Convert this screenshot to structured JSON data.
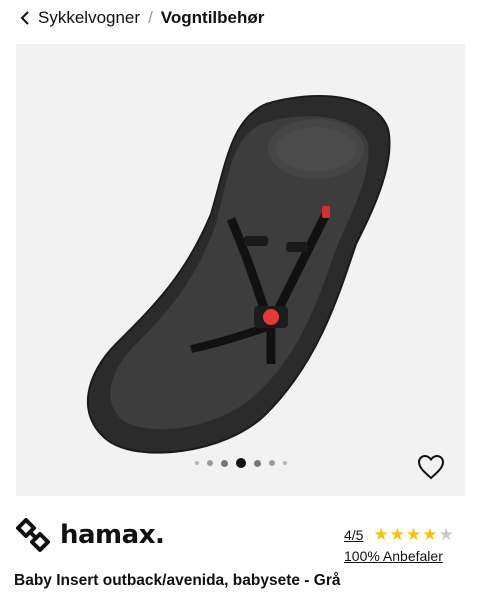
{
  "breadcrumb": {
    "back_label": "Sykkelvogner",
    "separator": "/",
    "current": "Vogntilbehør"
  },
  "gallery": {
    "image_alt": "Baby Insert outback/avenida, babysete - Grå",
    "dot_count": 7,
    "active_index": 3
  },
  "brand": {
    "name": "hamax."
  },
  "rating": {
    "score_label": "4/5",
    "stars_filled": 4,
    "stars_total": 5,
    "recommend_label": "100% Anbefaler",
    "star_color": "#f1c40f"
  },
  "product": {
    "title": "Baby Insert outback/avenida, babysete - Grå"
  }
}
